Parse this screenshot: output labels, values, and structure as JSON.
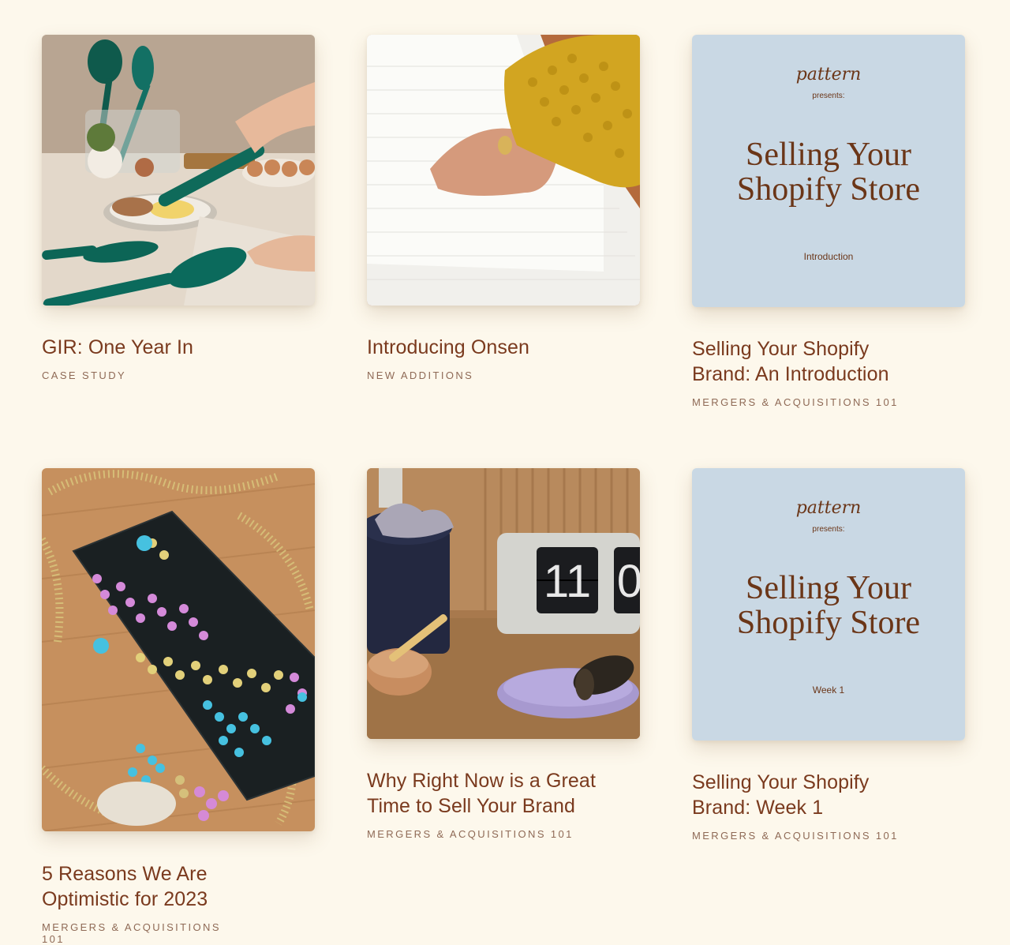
{
  "cards": [
    {
      "title": "GIR: One Year In",
      "tag": "CASE STUDY"
    },
    {
      "title": "Introducing Onsen",
      "tag": "NEW ADDITIONS"
    },
    {
      "title": "Selling Your Shopify Brand: An Introduction",
      "tag": "MERGERS & ACQUISITIONS 101",
      "cover": {
        "logo": "pattern",
        "presents": "presents:",
        "line1": "Selling Your",
        "line2": "Shopify Store",
        "sub": "Introduction"
      }
    },
    {
      "title": "5 Reasons We Are Optimistic for 2023",
      "tag": "MERGERS & ACQUISITIONS 101"
    },
    {
      "title": "Why Right Now is a Great Time to Sell Your Brand",
      "tag": "MERGERS & ACQUISITIONS 101",
      "clock": {
        "hour": "11",
        "minute": "0"
      }
    },
    {
      "title": "Selling Your Shopify Brand: Week 1",
      "tag": "MERGERS & ACQUISITIONS 101",
      "cover": {
        "logo": "pattern",
        "presents": "presents:",
        "line1": "Selling Your",
        "line2": "Shopify Store",
        "sub": "Week 1"
      }
    }
  ],
  "colors": {
    "background": "#fdf8ec",
    "title": "#7a3a1e",
    "tag": "#8f6a56",
    "cover": "#c9d8e4"
  }
}
